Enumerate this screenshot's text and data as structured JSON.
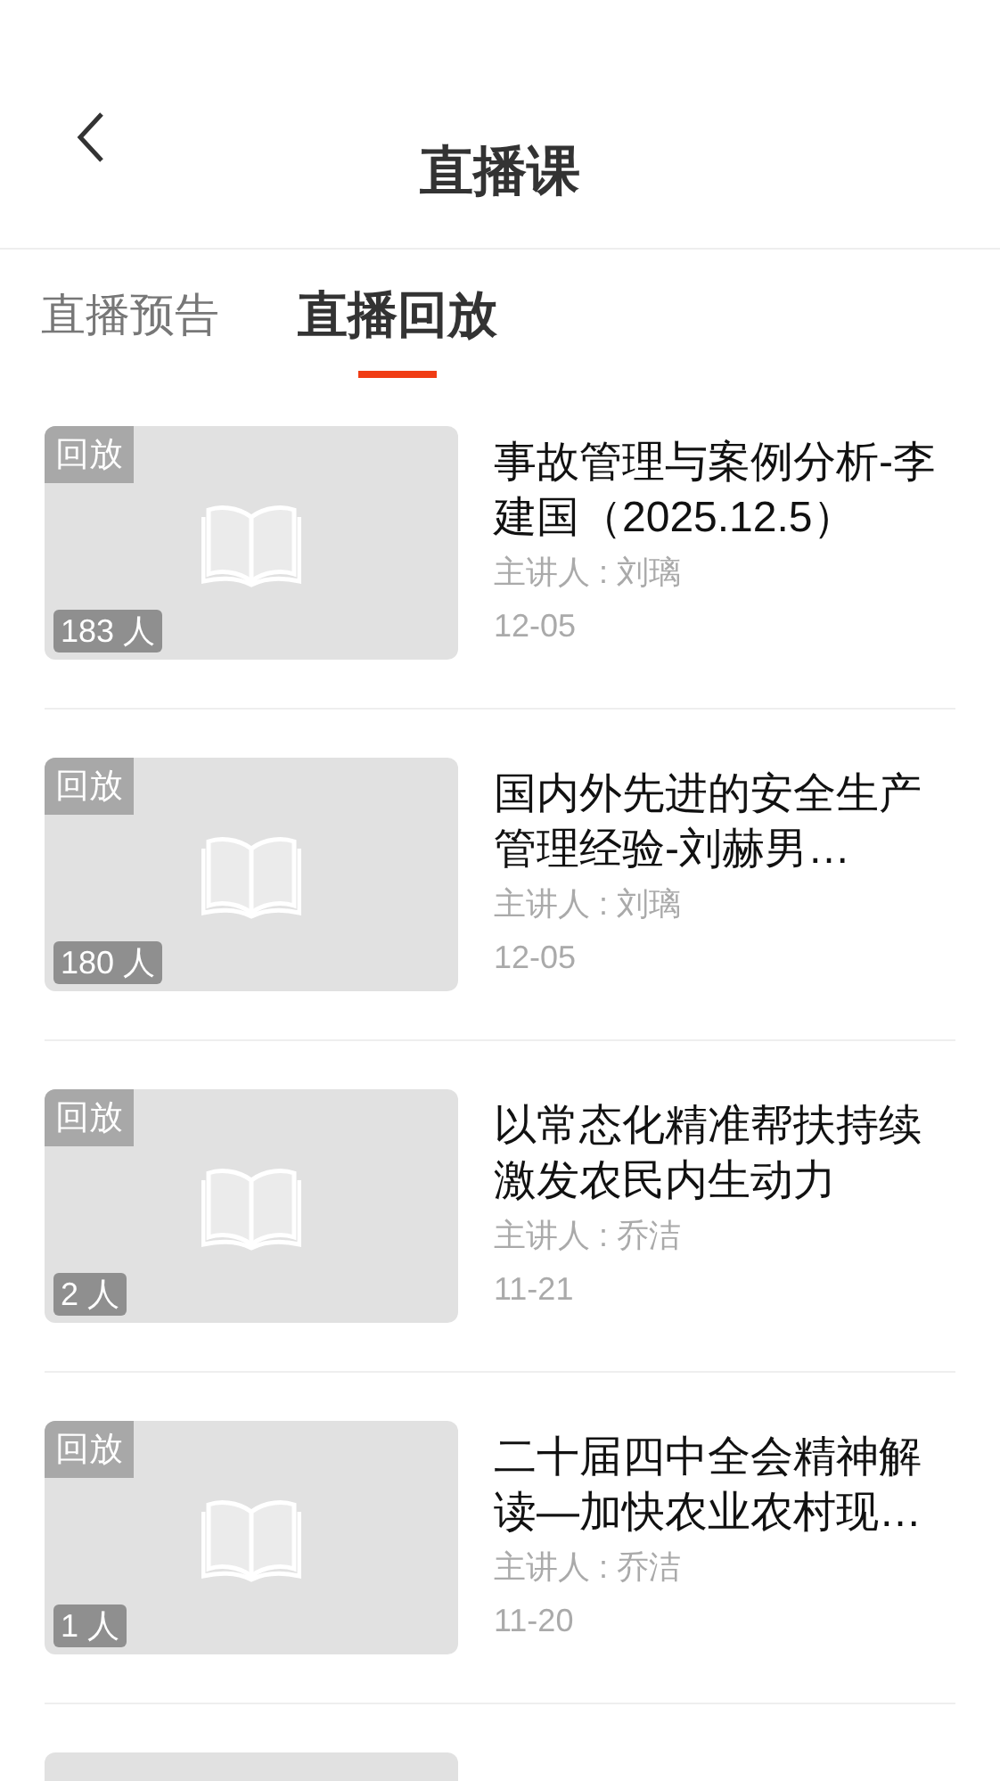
{
  "header": {
    "title": "直播课"
  },
  "tabs": [
    {
      "label": "直播预告",
      "selected": false
    },
    {
      "label": "直播回放",
      "selected": true
    }
  ],
  "items": [
    {
      "badge": "回放",
      "viewers": "183 人",
      "title": "事故管理与案例分析-李建国（2025.12.5）",
      "speaker": "主讲人 : 刘璃",
      "date": "12-05"
    },
    {
      "badge": "回放",
      "viewers": "180 人",
      "title": "国内外先进的安全生产管理经验-刘赫男…",
      "speaker": "主讲人 : 刘璃",
      "date": "12-05"
    },
    {
      "badge": "回放",
      "viewers": "2 人",
      "title": "以常态化精准帮扶持续激发农民内生动力",
      "speaker": "主讲人 : 乔洁",
      "date": "11-21"
    },
    {
      "badge": "回放",
      "viewers": "1 人",
      "title": "二十届四中全会精神解读—加快农业农村现…",
      "speaker": "主讲人 : 乔洁",
      "date": "11-20"
    }
  ],
  "more_below": true
}
